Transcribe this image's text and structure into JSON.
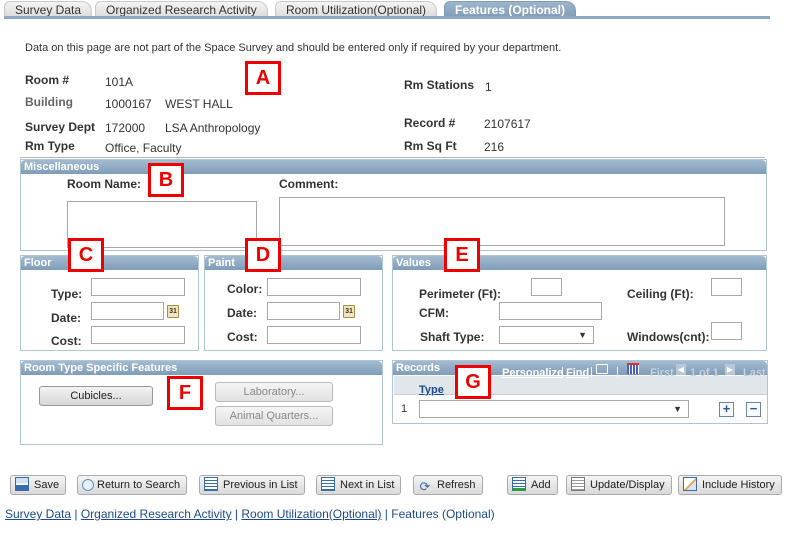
{
  "tabs": [
    {
      "label": "Survey Data",
      "active": false
    },
    {
      "label": "Organized Research Activity",
      "active": false
    },
    {
      "label": "Room Utilization(Optional)",
      "active": false
    },
    {
      "label": "Features (Optional)",
      "active": true
    }
  ],
  "note": "Data on this page are not part of the Space Survey and should be entered only if required by your department.",
  "header": {
    "room_label": "Room #",
    "room_value": "101A",
    "building_label": "Building",
    "building_code": "1000167",
    "building_name": "WEST HALL",
    "dept_label": "Survey Dept",
    "dept_code": "172000",
    "dept_name": "LSA Anthropology",
    "rmtype_label": "Rm Type",
    "rmtype_value": "Office, Faculty",
    "stations_label": "Rm Stations",
    "stations_value": "1",
    "record_label": "Record #",
    "record_value": "2107617",
    "sqft_label": "Rm Sq Ft",
    "sqft_value": "216"
  },
  "misc": {
    "title": "Miscellaneous",
    "room_name_label": "Room Name:",
    "room_name_value": "",
    "comment_label": "Comment:",
    "comment_value": ""
  },
  "floor": {
    "title": "Floor",
    "type_label": "Type:",
    "type_value": "",
    "date_label": "Date:",
    "date_value": "",
    "cost_label": "Cost:",
    "cost_value": "",
    "calendar_glyph": "31"
  },
  "paint": {
    "title": "Paint",
    "color_label": "Color:",
    "color_value": "",
    "date_label": "Date:",
    "date_value": "",
    "cost_label": "Cost:",
    "cost_value": "",
    "calendar_glyph": "31"
  },
  "values": {
    "title": "Values",
    "perimeter_label": "Perimeter (Ft):",
    "perimeter_value": "",
    "ceiling_label": "Ceiling (Ft):",
    "ceiling_value": "",
    "cfm_label": "CFM:",
    "cfm_value": "",
    "shaft_label": "Shaft Type:",
    "shaft_value": "",
    "windows_label": "Windows(cnt):",
    "windows_value": ""
  },
  "room_type_features": {
    "title": "Room Type Specific Features",
    "cubicles": "Cubicles...",
    "laboratory": "Laboratory...",
    "animal_quarters": "Animal Quarters..."
  },
  "records": {
    "title": "Records",
    "personalize": "Personalize",
    "find": "Find",
    "sep": "|",
    "first": "First",
    "range": "1 of 1",
    "last": "Last",
    "column_type": "Type",
    "rows": [
      {
        "num": "1",
        "type": ""
      }
    ],
    "add_glyph": "+",
    "remove_glyph": "−"
  },
  "markers": [
    "A",
    "B",
    "C",
    "D",
    "E",
    "F",
    "G"
  ],
  "toolbar": {
    "save": "Save",
    "return_to_search": "Return to Search",
    "previous_in_list": "Previous in List",
    "next_in_list": "Next in List",
    "refresh": "Refresh",
    "add": "Add",
    "update_display": "Update/Display",
    "include_history": "Include History"
  },
  "footer_links": {
    "survey_data": "Survey Data",
    "organized_research": "Organized Research Activity",
    "room_utilization": "Room Utilization(Optional)",
    "features": "Features (Optional)",
    "sep": "|"
  }
}
